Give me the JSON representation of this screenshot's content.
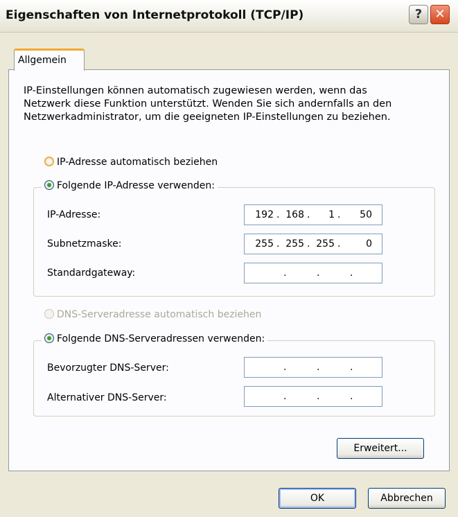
{
  "window": {
    "title": "Eigenschaften von Internetprotokoll (TCP/IP)",
    "help_label": "?",
    "close_label": "✕"
  },
  "tabs": [
    {
      "label": "Allgemein"
    }
  ],
  "description": "IP-Einstellungen können automatisch zugewiesen werden, wenn das Netzwerk diese Funktion unterstützt. Wenden Sie sich andernfalls an den Netzwerkadministrator, um die geeigneten IP-Einstellungen zu beziehen.",
  "ip": {
    "auto_label": "IP-Adresse automatisch beziehen",
    "auto_selected": false,
    "manual_label": "Folgende IP-Adresse verwenden:",
    "manual_selected": true,
    "fields": [
      {
        "label": "IP-Adresse:",
        "octets": [
          "192",
          "168",
          "1",
          "50"
        ]
      },
      {
        "label": "Subnetzmaske:",
        "octets": [
          "255",
          "255",
          "255",
          "0"
        ]
      },
      {
        "label": "Standardgateway:",
        "octets": [
          "",
          "",
          "",
          ""
        ]
      }
    ]
  },
  "dns": {
    "auto_label": "DNS-Serveradresse automatisch beziehen",
    "auto_enabled": false,
    "manual_label": "Folgende DNS-Serveradressen verwenden:",
    "manual_selected": true,
    "fields": [
      {
        "label": "Bevorzugter DNS-Server:",
        "octets": [
          "",
          "",
          "",
          ""
        ]
      },
      {
        "label": "Alternativer DNS-Server:",
        "octets": [
          "",
          "",
          "",
          ""
        ]
      }
    ]
  },
  "buttons": {
    "advanced": "Erweitert...",
    "ok": "OK",
    "cancel": "Abbrechen"
  },
  "colors": {
    "dialog_bg": "#ECE9D8",
    "panel_bg": "#FCFCFE",
    "tab_accent": "#F4A82E",
    "radio_dot": "#3D9A2F",
    "close_button": "#D4471F"
  }
}
